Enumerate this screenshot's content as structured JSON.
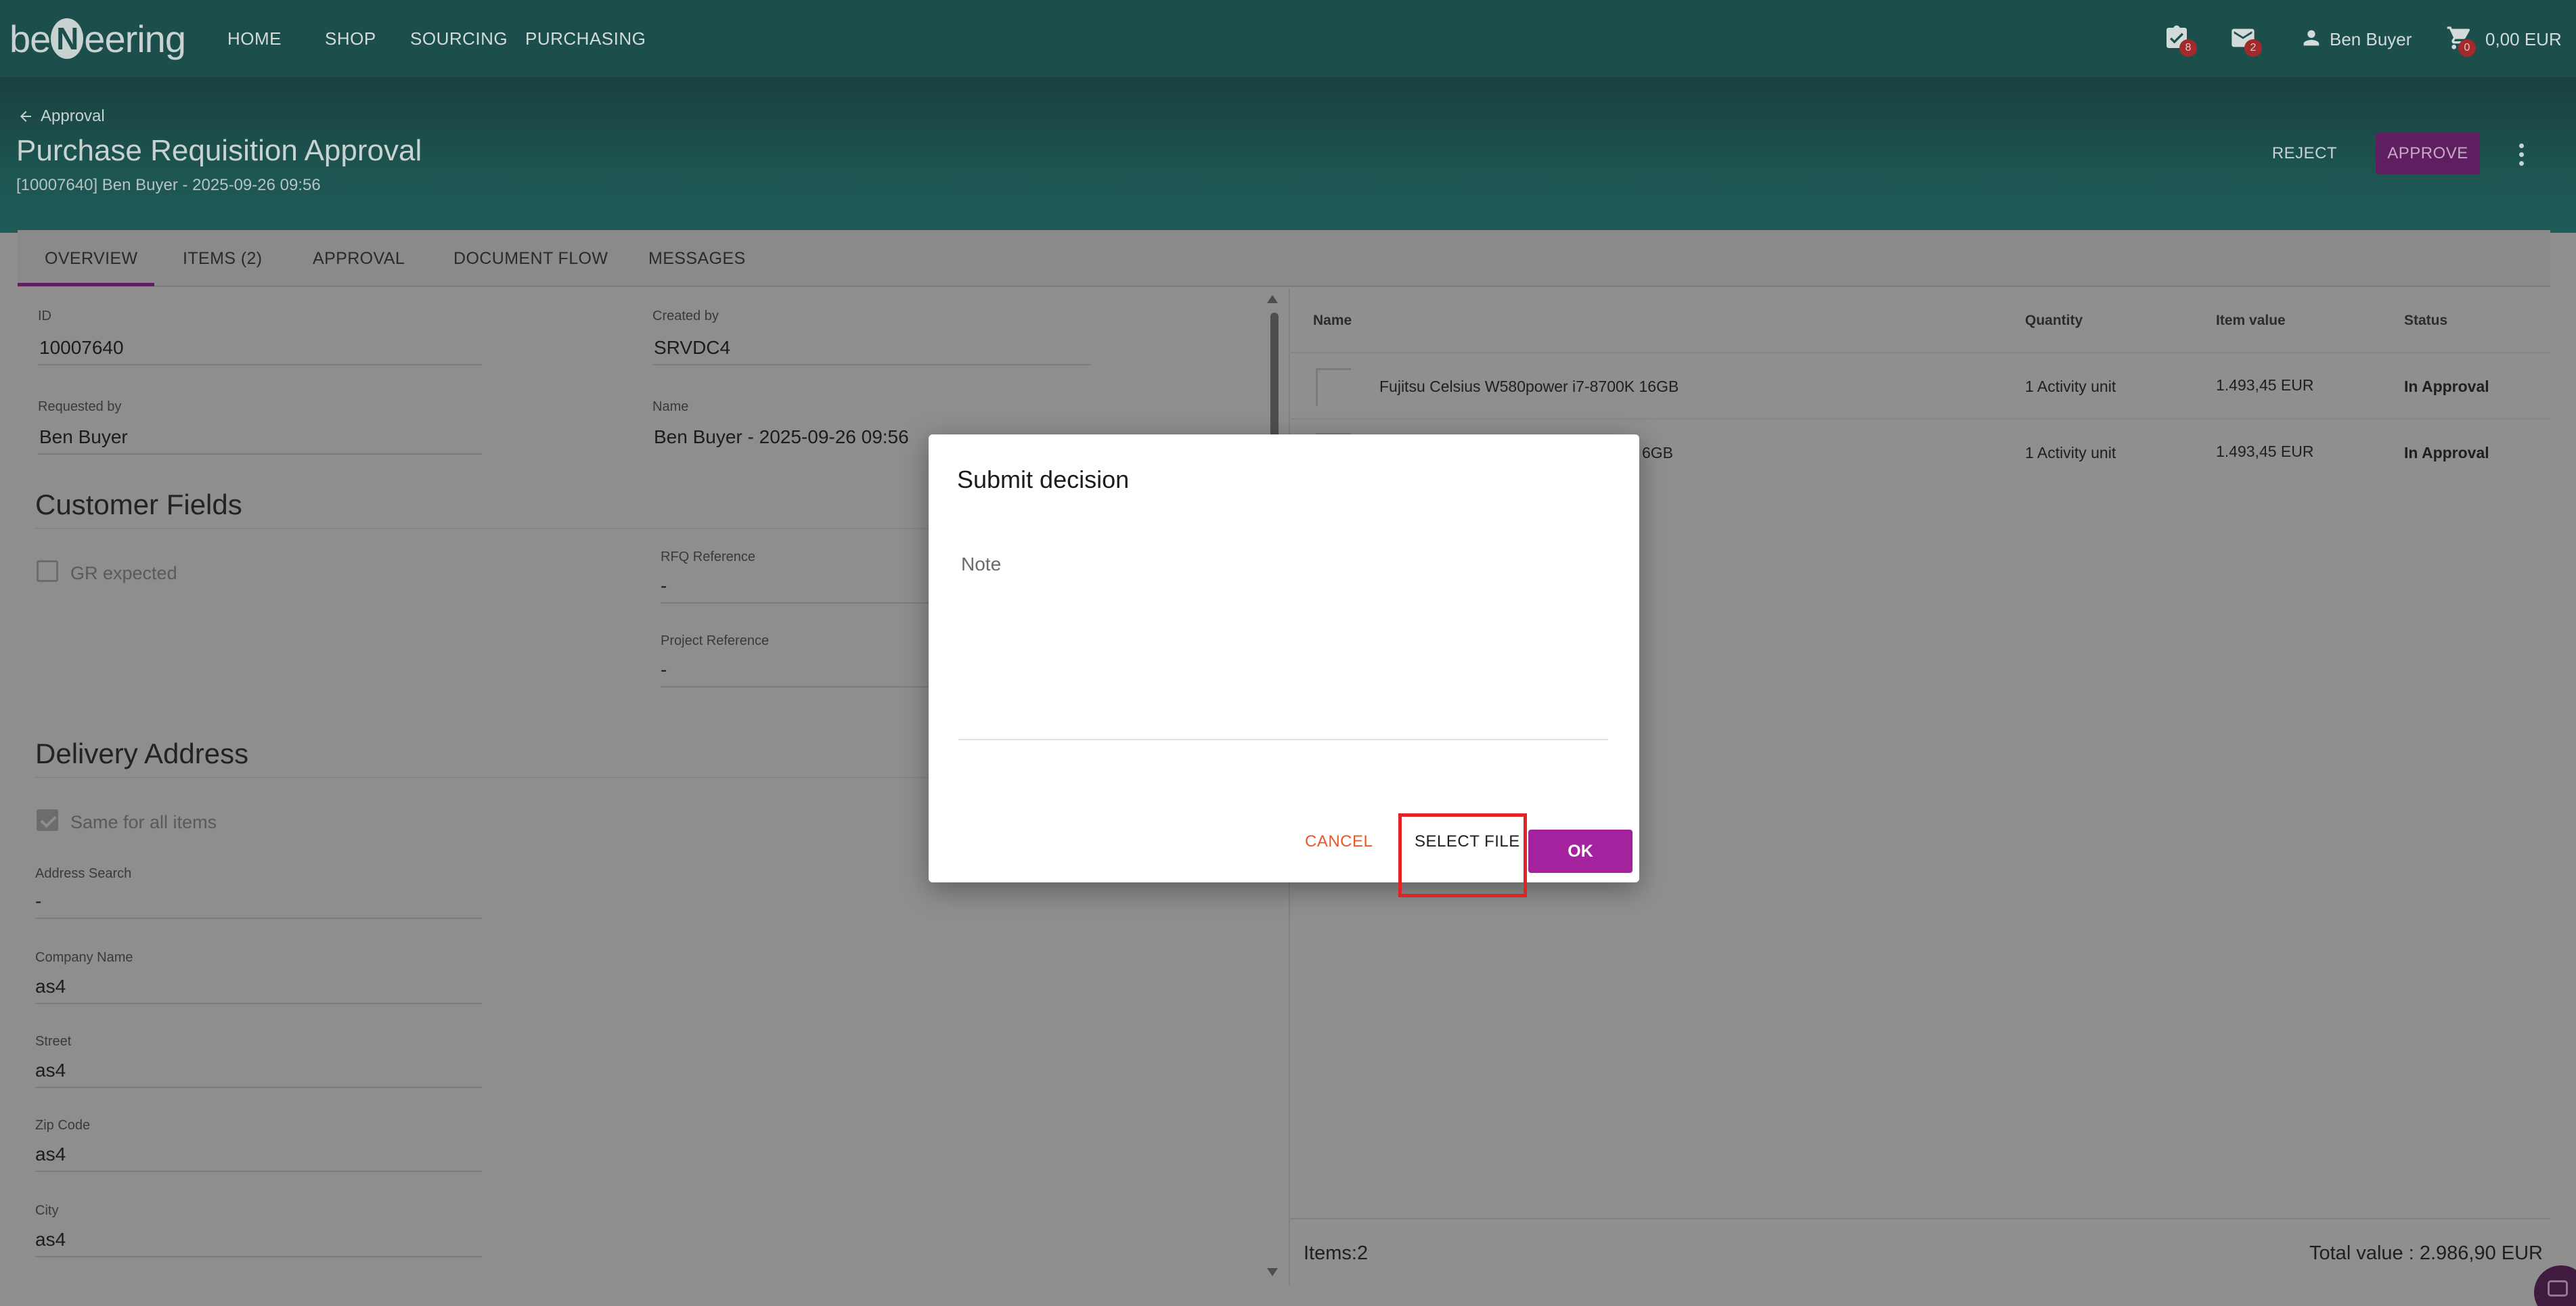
{
  "app": {
    "logo_text": "beNeering",
    "nav": [
      "HOME",
      "SHOP",
      "SOURCING",
      "PURCHASING"
    ],
    "tasks_badge": "8",
    "messages_badge": "2",
    "user_name": "Ben Buyer",
    "cart_badge": "0",
    "cart_value": "0,00 EUR",
    "icons": {
      "tasks": "checklist-icon",
      "messages": "mail-icon",
      "user": "person-icon",
      "cart": "cart-icon",
      "back": "arrow-left-icon",
      "more": "more-vert-icon"
    }
  },
  "header": {
    "back_label": "Approval",
    "title": "Purchase Requisition Approval",
    "subtitle": "[10007640] Ben Buyer - 2025-09-26 09:56",
    "reject_label": "REJECT",
    "approve_label": "APPROVE"
  },
  "tabs": [
    "OVERVIEW",
    "ITEMS (2)",
    "APPROVAL",
    "DOCUMENT FLOW",
    "MESSAGES"
  ],
  "overview": {
    "id_label": "ID",
    "id_value": "10007640",
    "created_by_label": "Created by",
    "created_by_value": "SRVDC4",
    "requested_by_label": "Requested by",
    "requested_by_value": "Ben Buyer",
    "name_label": "Name",
    "name_value": "Ben Buyer - 2025-09-26 09:56",
    "customer_fields_title": "Customer Fields",
    "gr_expected_label": "GR expected",
    "gr_expected_checked": false,
    "rfq_label": "RFQ Reference",
    "rfq_value": "-",
    "project_label": "Project Reference",
    "project_value": "-",
    "delivery_title": "Delivery Address",
    "same_for_all_label": "Same for all items",
    "same_for_all_checked": true,
    "address_search_label": "Address Search",
    "address_search_value": "-",
    "company_label": "Company Name",
    "company_value": "as4",
    "street_label": "Street",
    "street_value": "as4",
    "zip_label": "Zip Code",
    "zip_value": "as4",
    "city_label": "City",
    "city_value": "as4"
  },
  "items_table": {
    "headers": [
      "Name",
      "Quantity",
      "Item value",
      "Status"
    ],
    "rows": [
      {
        "name": "Fujitsu Celsius W580power i7-8700K 16GB",
        "quantity": "1 Activity unit",
        "value": "1.493,45 EUR",
        "status": "In Approval"
      },
      {
        "name": "6GB",
        "quantity": "1 Activity unit",
        "value": "1.493,45 EUR",
        "status": "In Approval"
      }
    ],
    "items_count": "Items:2",
    "total_value": "Total value : 2.986,90 EUR"
  },
  "modal": {
    "title": "Submit decision",
    "note_label": "Note",
    "note_value": "",
    "cancel_label": "CANCEL",
    "select_file_label": "SELECT FILE",
    "ok_label": "OK"
  },
  "colors": {
    "navbar": "#1c4f4c",
    "approve": "#5e1e5f",
    "ok_button": "#a5229f",
    "cancel_text": "#e8582a",
    "highlight": "#e02424"
  }
}
